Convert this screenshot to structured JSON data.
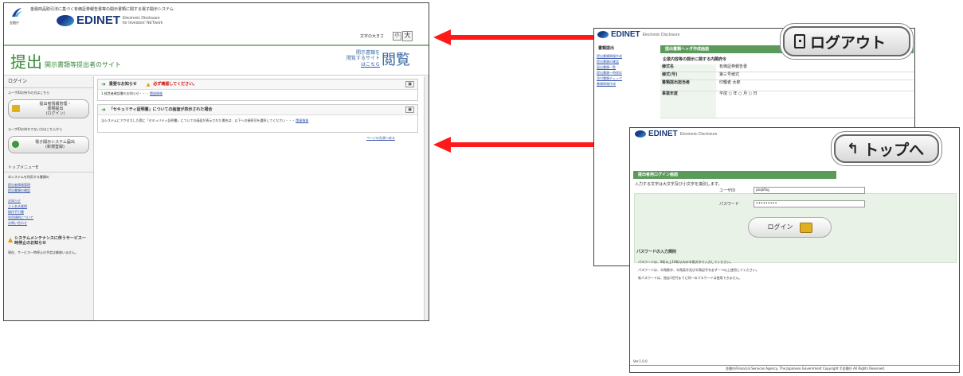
{
  "left": {
    "agency_label": "金融庁",
    "system_title": "金融商品取引法に基づく有価証券報告書等の開示書類に関する電子開示システム",
    "logo_text": "EDINET",
    "logo_sub1": "Electronic Disclosure",
    "logo_sub2": "for Investors' NETwork",
    "font_size_label": "文字の大きさ",
    "font_small": "小",
    "font_large": "大",
    "site_title_big": "提出",
    "site_title_rest": "開示書類等提出者のサイト",
    "view_site_line1": "開示書類を",
    "view_site_line2": "閲覧するサイト",
    "view_site_line3": "はこちら",
    "view_big": "閲覧",
    "sidebar": {
      "login_heading": "ログイン",
      "login_note": "ユーザIDお持ちの方はこちら",
      "login_button_line1": "提出者情報管理・",
      "login_button_line2": "書類提出",
      "login_button_line3": "(ログイン)",
      "register_note": "ユーザIDお持ちでない方はこちらから",
      "register_button_line1": "電子開示システム届出",
      "register_button_line2": "(新規登録)",
      "menu_heading": "トップメニューE",
      "menu_desc": "本システムを利用する書類の",
      "menu_items": [
        "提出者情報管理",
        "提出書類の確認",
        "お知らせ",
        "よくある質問",
        "操作手引書",
        "利用規約について",
        "お問い合わせ"
      ],
      "maintenance_title": "システムメンテナンスに伴うサービス一時停止のお知らせ",
      "maintenance_body": "現在、サービス一時停止の予定は御座いません。"
    },
    "notice1": {
      "title": "重要なお知らせ",
      "warning": "必ず確認してください。",
      "body": "1.経営者確認書のお知らせ・・・",
      "link": "関連情報"
    },
    "notice2": {
      "title": "「セキュリティ証明書」についての画面が表示された場合",
      "body": "当システムにアクセスした際に「セキュリティ証明書」についての画面が表示された場合は、以下への接続可を選択してください・・・",
      "link": "関連情報"
    },
    "page_top_link": "ページの先頭へ戻る"
  },
  "right_top": {
    "logo_text": "EDINET",
    "logo_sub": "Electronic Disclosure",
    "side_heading": "書類提出",
    "side_items": [
      "提出書類情報作成",
      "提出書類の確認",
      "届出書類一覧",
      "提出書類一時保存",
      "添付書類チェック",
      "書類情報作成"
    ],
    "panel_title": "提出書類ヘッダ作成画面",
    "form_title": "企業内容等の開示に関する内閣府令",
    "rows": [
      {
        "label": "様式名",
        "value": "有価証券報告書"
      },
      {
        "label": "様式(号)",
        "value": "第三号様式"
      },
      {
        "label": "書類提出担当者",
        "value": "印鑑者  太郎"
      },
      {
        "label": "事業年度",
        "value": "平成 ○ 年 ○ 月 ○ 日"
      }
    ],
    "callout": "ログアウト"
  },
  "right_bottom": {
    "logo_text": "EDINET",
    "logo_sub": "Electronic Disclosure",
    "bar_title": "提出者用ログイン画面",
    "instruction": "入力する文字は大文字及び小文字を識別します。",
    "user_label": "ユーザID",
    "user_value": "pbqbfbg",
    "pass_label": "パスワード",
    "pass_value": "•••••••••",
    "login_button": "ログイン",
    "rules_heading": "パスワードの入力規則",
    "rules": [
      "パスワードは、8桁以上16桁以内の半角文字で入力してください。",
      "パスワードは、半角数字、半角英字及び半角記号を必ず一つ以上使用してください。",
      "新パスワードは、過去1世代までと同一のパスワードは使用できません。"
    ],
    "version": "Ver.1.0.0",
    "copyright": "金融庁/Financial Services Agency, The Japanese Government Copyright ©金融庁 All Rights Reserved.",
    "callout": "トップへ"
  },
  "colors": {
    "arrow": "#ff1a1a",
    "accent_green": "#5a9a5a",
    "edinet_blue": "#1a3a7a"
  }
}
